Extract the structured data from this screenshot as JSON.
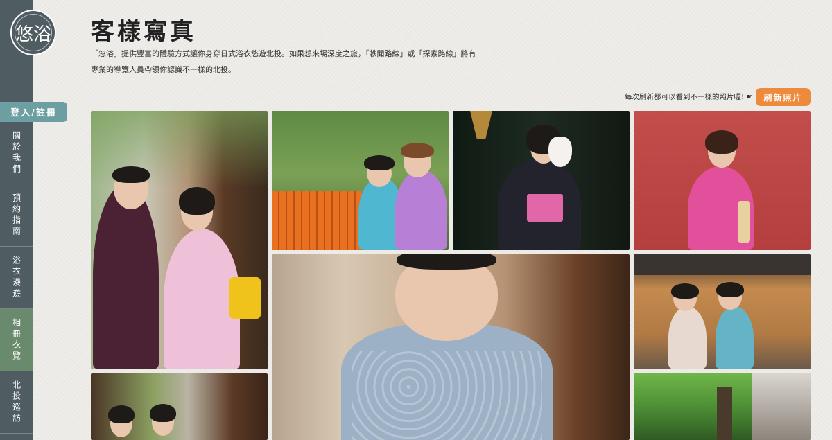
{
  "logo": {
    "text": "悠浴"
  },
  "sidebar": {
    "login_label": "登入/註冊",
    "items": [
      {
        "label": "關於我們",
        "active": false
      },
      {
        "label": "預約指南",
        "active": false
      },
      {
        "label": "浴衣漫遊",
        "active": false
      },
      {
        "label": "相冊衣覽",
        "active": true
      },
      {
        "label": "北投巡訪",
        "active": false
      }
    ]
  },
  "page": {
    "title": "客樣寫真",
    "intro_line1": "「忽浴」提供豐富的體驗方式讓你身穿日式浴衣悠遊北投。如果想來場深度之旅，「軼聞路線」或「探索路線」將有",
    "intro_line2": "專業的導覽人員帶領你認識不一樣的北投。",
    "refresh_hint": "每次刷新都可以看到不一樣的照片喔! ☛",
    "refresh_label": "刷新照片"
  },
  "gallery": {
    "photos": [
      {
        "name": "couple-in-yukata-street"
      },
      {
        "name": "mother-daughter-yukata"
      },
      {
        "name": "girl-with-fox-mask"
      },
      {
        "name": "girl-pink-kimono-red-wall"
      },
      {
        "name": "boy-blue-yukata"
      },
      {
        "name": "two-girls-wooden-house"
      },
      {
        "name": "two-girls-alley"
      },
      {
        "name": "garden-trees"
      }
    ]
  },
  "colors": {
    "sidebar": "#4f5d62",
    "login": "#6c9ea2",
    "active_nav": "#6a8a6e",
    "refresh": "#ee8a3c"
  }
}
